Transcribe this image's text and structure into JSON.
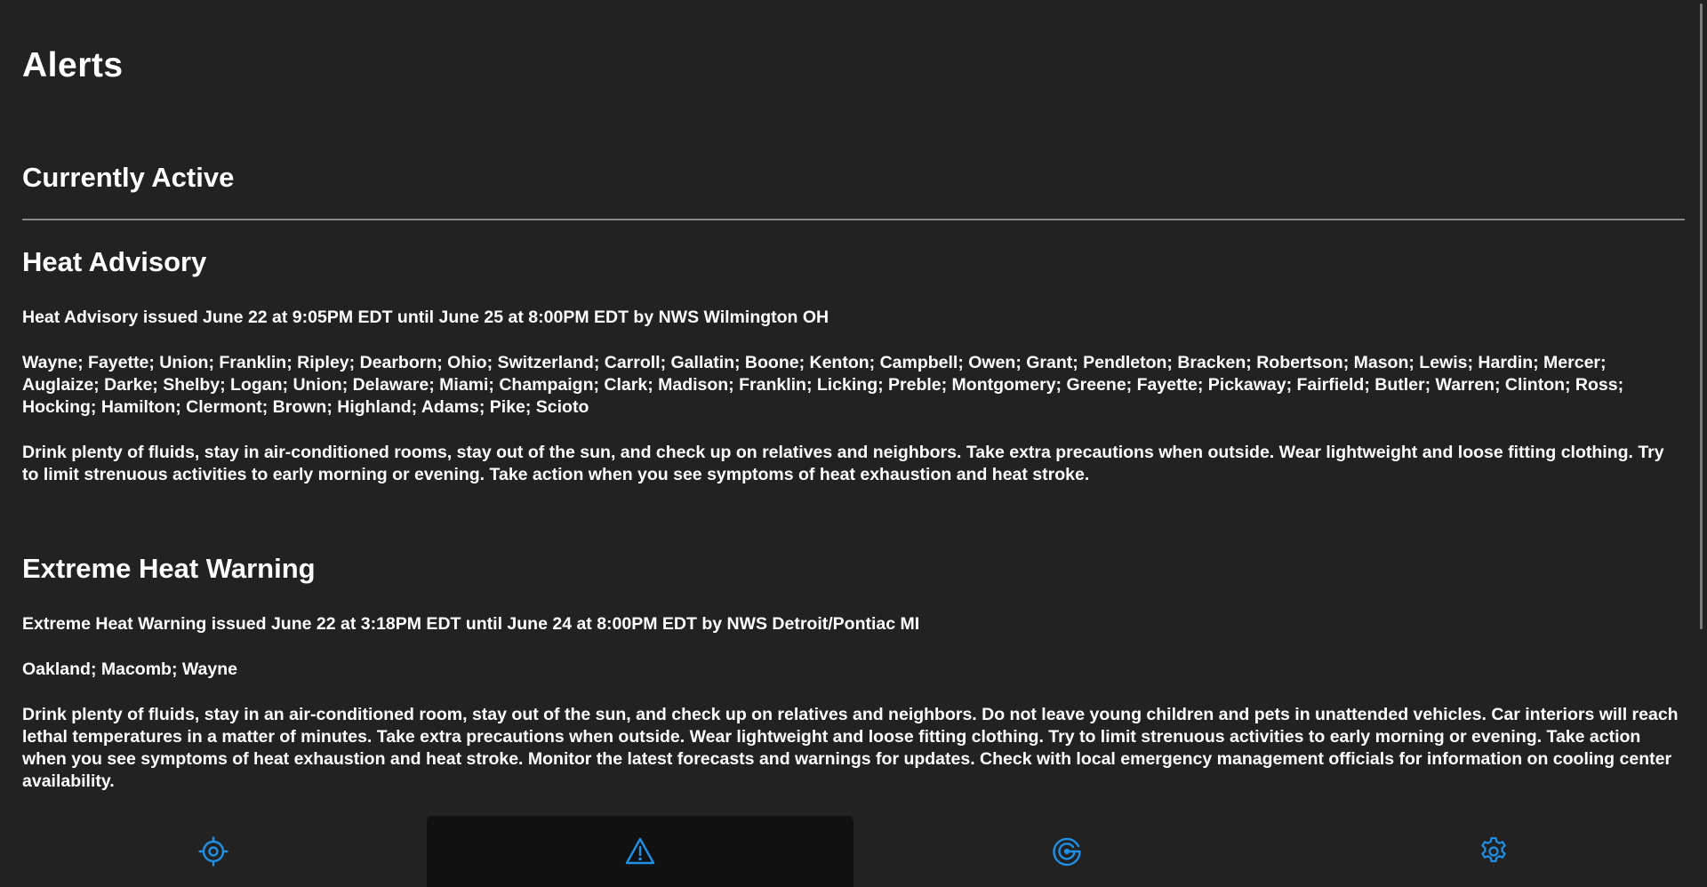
{
  "page": {
    "title": "Alerts",
    "section_title": "Currently Active"
  },
  "alerts": [
    {
      "title": "Heat Advisory",
      "issued": "Heat Advisory issued June 22 at 9:05PM EDT until June 25 at 8:00PM EDT by NWS Wilmington OH",
      "areas": "Wayne; Fayette; Union; Franklin; Ripley; Dearborn; Ohio; Switzerland; Carroll; Gallatin; Boone; Kenton; Campbell; Owen; Grant; Pendleton; Bracken; Robertson; Mason; Lewis; Hardin; Mercer; Auglaize; Darke; Shelby; Logan; Union; Delaware; Miami; Champaign; Clark; Madison; Franklin; Licking; Preble; Montgomery; Greene; Fayette; Pickaway; Fairfield; Butler; Warren; Clinton; Ross; Hocking; Hamilton; Clermont; Brown; Highland; Adams; Pike; Scioto",
      "instructions": "Drink plenty of fluids, stay in air-conditioned rooms, stay out of the sun, and check up on relatives and neighbors. Take extra precautions when outside. Wear lightweight and loose fitting clothing. Try to limit strenuous activities to early morning or evening. Take action when you see symptoms of heat exhaustion and heat stroke."
    },
    {
      "title": "Extreme Heat Warning",
      "issued": "Extreme Heat Warning issued June 22 at 3:18PM EDT until June 24 at 8:00PM EDT by NWS Detroit/Pontiac MI",
      "areas": "Oakland; Macomb; Wayne",
      "instructions": "Drink plenty of fluids, stay in an air-conditioned room, stay out of the sun, and check up on relatives and neighbors. Do not leave young children and pets in unattended vehicles. Car interiors will reach lethal temperatures in a matter of minutes. Take extra precautions when outside. Wear lightweight and loose fitting clothing. Try to limit strenuous activities to early morning or evening. Take action when you see symptoms of heat exhaustion and heat stroke. Monitor the latest forecasts and warnings for updates. Check with local emergency management officials for information on cooling center availability."
    }
  ],
  "nav": {
    "items": [
      {
        "icon": "location-crosshair-icon",
        "active": false
      },
      {
        "icon": "alert-triangle-icon",
        "active": true
      },
      {
        "icon": "radar-icon",
        "active": false
      },
      {
        "icon": "gear-icon",
        "active": false
      }
    ],
    "accent_color": "#1e90e6",
    "active_bg": "#111111"
  },
  "colors": {
    "background": "#222222",
    "text": "#ffffff",
    "divider": "#8a8a8a"
  }
}
